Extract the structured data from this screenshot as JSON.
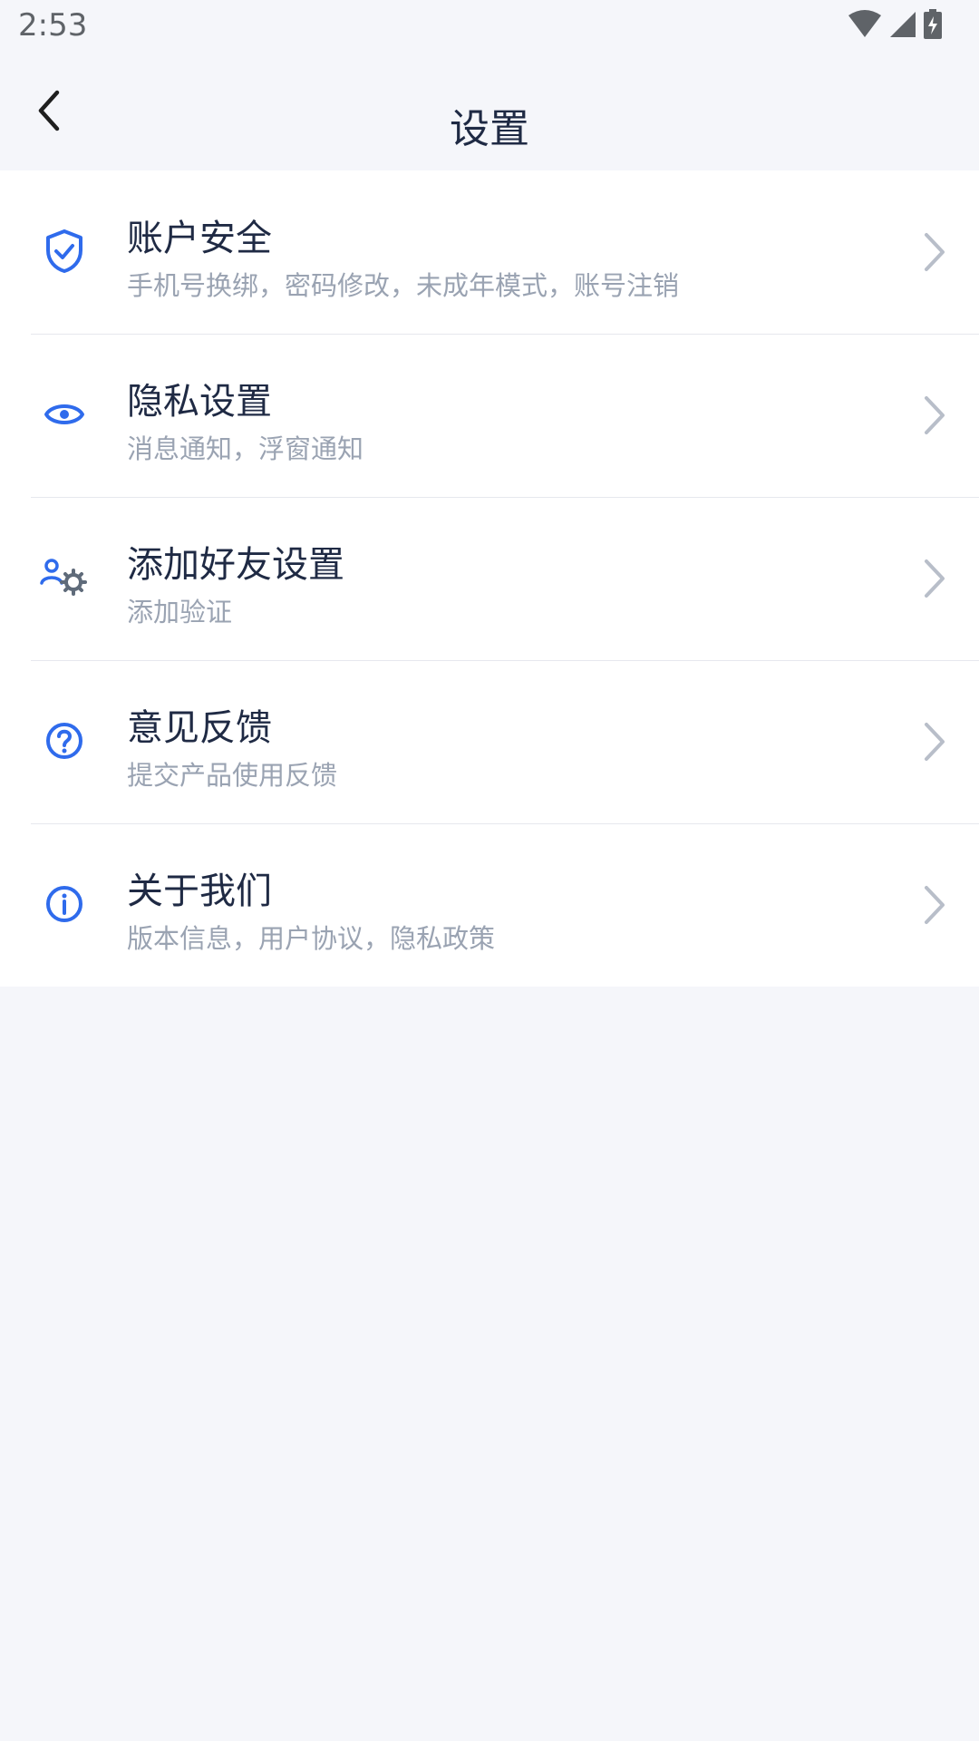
{
  "status_bar": {
    "time": "2:53",
    "icons": [
      "wifi-icon",
      "cell-signal-icon",
      "battery-charging-icon"
    ]
  },
  "header": {
    "title": "设置",
    "back_icon": "chevron-left-icon"
  },
  "colors": {
    "accent": "#2f6bec",
    "background": "#f5f6fa",
    "card": "#ffffff",
    "title_text": "#1f2a44",
    "subtitle_text": "#9aa3b2",
    "chevron": "#b8bec9"
  },
  "settings": {
    "items": [
      {
        "title": "账户安全",
        "subtitle": "手机号换绑，密码修改，未成年模式，账号注销",
        "icon": "shield-check-icon"
      },
      {
        "title": "隐私设置",
        "subtitle": "消息通知，浮窗通知",
        "icon": "eye-icon"
      },
      {
        "title": "添加好友设置",
        "subtitle": "添加验证",
        "icon": "user-gear-icon"
      },
      {
        "title": "意见反馈",
        "subtitle": "提交产品使用反馈",
        "icon": "question-circle-icon"
      },
      {
        "title": "关于我们",
        "subtitle": "版本信息，用户协议，隐私政策",
        "icon": "info-circle-icon"
      }
    ]
  }
}
